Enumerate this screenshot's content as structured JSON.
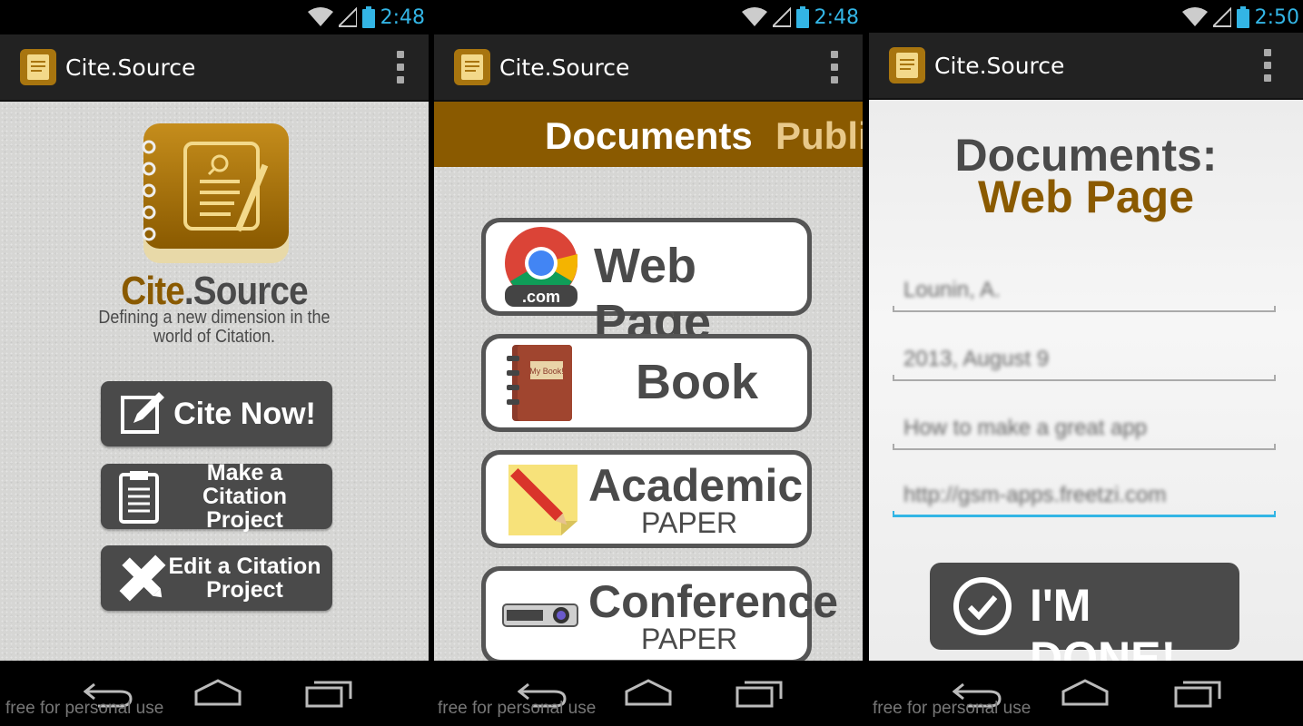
{
  "app": {
    "title": "Cite.Source"
  },
  "screens": [
    {
      "status": {
        "time": "2:48"
      },
      "brand": {
        "part1": "Cite",
        "part2": ".Source"
      },
      "tagline": {
        "line1": "Defining a new dimension in the",
        "line2": "world of Citation."
      },
      "buttons": {
        "cite_now": "Cite Now!",
        "make_line1": "Make a Citation",
        "make_line2": "Project",
        "edit_line1": "Edit a Citation",
        "edit_line2": "Project"
      },
      "watermark": "free for personal use"
    },
    {
      "status": {
        "time": "2:48"
      },
      "tabs": {
        "active": "Documents",
        "next": "Publi"
      },
      "documents": {
        "web_page": "Web Page",
        "web_badge": ".com",
        "book": "Book",
        "notebook_label": "My Book!",
        "academic": "Academic",
        "academic_sub": "PAPER",
        "conference": "Conference",
        "conference_sub": "PAPER"
      },
      "watermark": "free for personal use"
    },
    {
      "status": {
        "time": "2:50"
      },
      "heading": {
        "line1": "Documents:",
        "line2": "Web Page"
      },
      "fields": [
        {
          "value": "Lounin, A."
        },
        {
          "value": "2013, August 9"
        },
        {
          "value": "How to make a great app"
        },
        {
          "value": "http://gsm-apps.freetzi.com"
        }
      ],
      "done_button": "I'M DONE!",
      "watermark": "free for personal use"
    }
  ],
  "colors": {
    "brown": "#8a5a00",
    "dark_gray": "#4a4a4a",
    "holo_blue": "#33b5e5"
  }
}
